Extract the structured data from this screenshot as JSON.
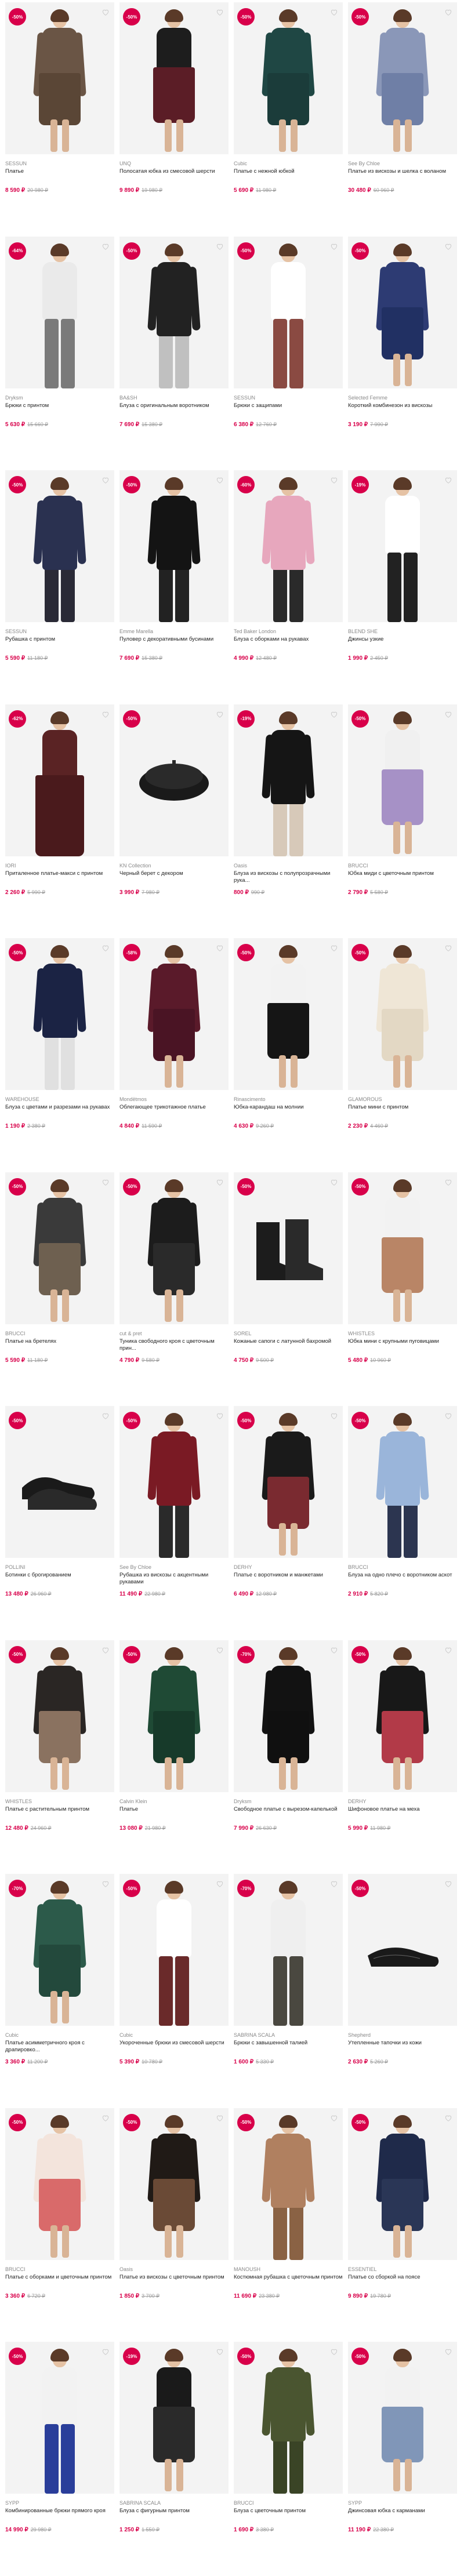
{
  "colors": {
    "accent": "#d8004a",
    "muted": "#9a9a9a"
  },
  "products": [
    {
      "badge": "-50%",
      "brand": "SESSUN",
      "name": "Платье",
      "price": "8 590 ₽",
      "old": "20 980 ₽",
      "kind": "dress",
      "c1": "#6a5545",
      "c2": "#5a4636"
    },
    {
      "badge": "-50%",
      "brand": "UNQ",
      "name": "Полосатая юбка из смесовой шерсти",
      "price": "9 890 ₽",
      "old": "19 980 ₽",
      "kind": "skirt",
      "c1": "#1d1d1d",
      "c2": "#5b1d26"
    },
    {
      "badge": "-50%",
      "brand": "Cubic",
      "name": "Платье с нежной юбкой",
      "price": "5 690 ₽",
      "old": "11 980 ₽",
      "kind": "dress",
      "c1": "#1f4744",
      "c2": "#1b3c3a"
    },
    {
      "badge": "-50%",
      "brand": "See By Chloe",
      "name": "Платье из вискозы и шелка с воланом",
      "price": "30 480 ₽",
      "old": "60 960 ₽",
      "kind": "dress",
      "c1": "#8a97b8",
      "c2": "#6f7fa6"
    },
    {
      "badge": "-64%",
      "brand": "Dryksm",
      "name": "Брюки с принтом",
      "price": "5 630 ₽",
      "old": "15 660 ₽",
      "kind": "pants",
      "c1": "#eaeaea",
      "c2": "#7a7a7a"
    },
    {
      "badge": "-50%",
      "brand": "BA&SH",
      "name": "Блуза с оригинальным воротником",
      "price": "7 690 ₽",
      "old": "15 380 ₽",
      "kind": "blouse",
      "c1": "#222222",
      "c2": "#c0c0c0"
    },
    {
      "badge": "-50%",
      "brand": "SESSUN",
      "name": "Брюки с защипами",
      "price": "6 380 ₽",
      "old": "12 760 ₽",
      "kind": "pants",
      "c1": "#ffffff",
      "c2": "#8a4a42"
    },
    {
      "badge": "-50%",
      "brand": "Selected Femme",
      "name": "Короткий комбинезон из вискозы",
      "price": "3 190 ₽",
      "old": "7 990 ₽",
      "kind": "dress",
      "c1": "#2d3b73",
      "c2": "#213063"
    },
    {
      "badge": "-50%",
      "brand": "SESSUN",
      "name": "Рубашка с принтом",
      "price": "5 590 ₽",
      "old": "11 180 ₽",
      "kind": "blouse",
      "c1": "#2a3150",
      "c2": "#2a2a36"
    },
    {
      "badge": "-50%",
      "brand": "Emme Marella",
      "name": "Пуловер с декоративными бусинами",
      "price": "7 690 ₽",
      "old": "15 380 ₽",
      "kind": "blouse",
      "c1": "#141414",
      "c2": "#222222"
    },
    {
      "badge": "-60%",
      "brand": "Ted Baker London",
      "name": "Блуза с оборками на рукавах",
      "price": "4 990 ₽",
      "old": "12 480 ₽",
      "kind": "blouse",
      "c1": "#e7a7bd",
      "c2": "#2a2a2a"
    },
    {
      "badge": "-19%",
      "brand": "BLEND SHE",
      "name": "Джинсы узкие",
      "price": "1 990 ₽",
      "old": "2 450 ₽",
      "kind": "pants",
      "c1": "#ffffff",
      "c2": "#222222"
    },
    {
      "badge": "-62%",
      "brand": "IORI",
      "name": "Приталенное платье-макси с принтом",
      "price": "2 260 ₽",
      "old": "5 990 ₽",
      "kind": "maxi",
      "c1": "#5a2324",
      "c2": "#4a1a1c"
    },
    {
      "badge": "-50%",
      "brand": "KN Collection",
      "name": "Черный берет с декором",
      "price": "3 990 ₽",
      "old": "7 980 ₽",
      "kind": "beret",
      "c1": "#1a1a1a",
      "c2": "#1a1a1a"
    },
    {
      "badge": "-19%",
      "brand": "Oasis",
      "name": "Блуза из вискозы с полупрозрачными рука...",
      "price": "800 ₽",
      "old": "990 ₽",
      "kind": "blouse",
      "c1": "#151515",
      "c2": "#d7c9b9"
    },
    {
      "badge": "-50%",
      "brand": "BRUCCI",
      "name": "Юбка миди с цветочным принтом",
      "price": "2 790 ₽",
      "old": "5 580 ₽",
      "kind": "skirt",
      "c1": "#f0f0f0",
      "c2": "#a691c6"
    },
    {
      "badge": "-50%",
      "brand": "WAREHOUSE",
      "name": "Блуза с цветами и разрезами на рукавах",
      "price": "1 190 ₽",
      "old": "2 380 ₽",
      "kind": "blouse",
      "c1": "#1b2344",
      "c2": "#e0e0e0"
    },
    {
      "badge": "-58%",
      "brand": "Mondëtmos",
      "name": "Облегающее трикотажное платье",
      "price": "4 840 ₽",
      "old": "11 590 ₽",
      "kind": "dress",
      "c1": "#5a1a2a",
      "c2": "#4a1424"
    },
    {
      "badge": "-50%",
      "brand": "Rinascimento",
      "name": "Юбка-карандаш на молнии",
      "price": "4 630 ₽",
      "old": "9 260 ₽",
      "kind": "skirt",
      "c1": "#f2f2f2",
      "c2": "#151515"
    },
    {
      "badge": "-50%",
      "brand": "GLAMOROUS",
      "name": "Платье мини с принтом",
      "price": "2 230 ₽",
      "old": "4 460 ₽",
      "kind": "dress",
      "c1": "#efe6d6",
      "c2": "#e3d8c4"
    },
    {
      "badge": "-50%",
      "brand": "BRUCCI",
      "name": "Платье на бретелях",
      "price": "5 590 ₽",
      "old": "11 180 ₽",
      "kind": "dress",
      "c1": "#3a3a3a",
      "c2": "#6e6050"
    },
    {
      "badge": "-50%",
      "brand": "cut & pret",
      "name": "Туника свободного кроя с цветочным прин...",
      "price": "4 790 ₽",
      "old": "9 580 ₽",
      "kind": "dress",
      "c1": "#1c1c1c",
      "c2": "#2a2a2a"
    },
    {
      "badge": "-50%",
      "brand": "SOREL",
      "name": "Кожаные сапоги с латунной бахромой",
      "price": "4 750 ₽",
      "old": "9 500 ₽",
      "kind": "boots",
      "c1": "#1c1c1c",
      "c2": "#1c1c1c"
    },
    {
      "badge": "-50%",
      "brand": "WHISTLES",
      "name": "Юбка мини с крупными пуговицами",
      "price": "5 480 ₽",
      "old": "10 960 ₽",
      "kind": "skirt",
      "c1": "#f2f2f2",
      "c2": "#b98566"
    },
    {
      "badge": "-50%",
      "brand": "POLLINI",
      "name": "Ботинки с брогированием",
      "price": "13 480 ₽",
      "old": "26 960 ₽",
      "kind": "shoes",
      "c1": "#1a1a1a",
      "c2": "#1a1a1a"
    },
    {
      "badge": "-50%",
      "brand": "See By Chloe",
      "name": "Рубашка из вискозы с акцентными рукавами",
      "price": "11 490 ₽",
      "old": "22 980 ₽",
      "kind": "blouse",
      "c1": "#7a1a24",
      "c2": "#2a2a2a"
    },
    {
      "badge": "-50%",
      "brand": "DERHY",
      "name": "Платье с воротником и манжетами",
      "price": "6 490 ₽",
      "old": "12 980 ₽",
      "kind": "dress",
      "c1": "#1a1a1a",
      "c2": "#7a2a30"
    },
    {
      "badge": "-50%",
      "brand": "BRUCCI",
      "name": "Блуза на одно плечо с воротником аскот",
      "price": "2 910 ₽",
      "old": "5 820 ₽",
      "kind": "blouse",
      "c1": "#9ab5da",
      "c2": "#2c3550"
    },
    {
      "badge": "-50%",
      "brand": "WHISTLES",
      "name": "Платье с растительным принтом",
      "price": "12 480 ₽",
      "old": "24 960 ₽",
      "kind": "dress",
      "c1": "#2a2624",
      "c2": "#8a7260"
    },
    {
      "badge": "-50%",
      "brand": "Calvin Klein",
      "name": "Платье",
      "price": "13 080 ₽",
      "old": "21 980 ₽",
      "kind": "dress",
      "c1": "#1f4a35",
      "c2": "#173a2a"
    },
    {
      "badge": "-70%",
      "brand": "Dryksm",
      "name": "Свободное платье с вырезом-капелькой",
      "price": "7 990 ₽",
      "old": "26 630 ₽",
      "kind": "dress",
      "c1": "#121212",
      "c2": "#101010"
    },
    {
      "badge": "-50%",
      "brand": "DERHY",
      "name": "Шифоновое платье на меха",
      "price": "5 990 ₽",
      "old": "11 980 ₽",
      "kind": "dress",
      "c1": "#181818",
      "c2": "#b23a48"
    },
    {
      "badge": "-70%",
      "brand": "Cubic",
      "name": "Платье асимметричного кроя с драпировко...",
      "price": "3 360 ₽",
      "old": "11 200 ₽",
      "kind": "dress",
      "c1": "#2c5a4a",
      "c2": "#23493c"
    },
    {
      "badge": "-50%",
      "brand": "Cubic",
      "name": "Укороченные брюки из смесовой шерсти",
      "price": "5 390 ₽",
      "old": "10 780 ₽",
      "kind": "pants",
      "c1": "#ffffff",
      "c2": "#6a2a2a"
    },
    {
      "badge": "-70%",
      "brand": "SABRINA SCALA",
      "name": "Брюки с завышенной талией",
      "price": "1 600 ₽",
      "old": "5 330 ₽",
      "kind": "pants",
      "c1": "#efefef",
      "c2": "#4a4840"
    },
    {
      "badge": "-50%",
      "brand": "Shepherd",
      "name": "Утепленные тапочки из кожи",
      "price": "2 630 ₽",
      "old": "5 260 ₽",
      "kind": "slippers",
      "c1": "#1a1a1a",
      "c2": "#1a1a1a"
    },
    {
      "badge": "-50%",
      "brand": "BRUCCI",
      "name": "Платье с оборками и цветочным принтом",
      "price": "3 360 ₽",
      "old": "6 720 ₽",
      "kind": "dress",
      "c1": "#f3e4dc",
      "c2": "#d96a6a"
    },
    {
      "badge": "-50%",
      "brand": "Oasis",
      "name": "Платье из вискозы с цветочным принтом",
      "price": "1 850 ₽",
      "old": "3 700 ₽",
      "kind": "dress",
      "c1": "#201a16",
      "c2": "#6a4a36"
    },
    {
      "badge": "-50%",
      "brand": "MANOUSH",
      "name": "Костюмная рубашка с цветочным принтом",
      "price": "11 690 ₽",
      "old": "23 380 ₽",
      "kind": "blouse",
      "c1": "#b08060",
      "c2": "#8a6244"
    },
    {
      "badge": "-50%",
      "brand": "ESSENTIEL",
      "name": "Платье со сборкой на поясе",
      "price": "9 890 ₽",
      "old": "19 780 ₽",
      "kind": "dress",
      "c1": "#1f2a4a",
      "c2": "#2a3656"
    },
    {
      "badge": "-50%",
      "brand": "SYPP",
      "name": "Комбинированные брюки прямого кроя",
      "price": "14 990 ₽",
      "old": "29 980 ₽",
      "kind": "pants",
      "c1": "#f2f2f2",
      "c2": "#2a3e9a"
    },
    {
      "badge": "-19%",
      "brand": "SABRINA SCALA",
      "name": "Блуза с фигурным принтом",
      "price": "1 250 ₽",
      "old": "1 550 ₽",
      "kind": "skirt",
      "c1": "#1a1a1a",
      "c2": "#2a2a2a"
    },
    {
      "badge": "-50%",
      "brand": "BRUCCI",
      "name": "Блуза с цветочным принтом",
      "price": "1 690 ₽",
      "old": "3 380 ₽",
      "kind": "blouse",
      "c1": "#4a5530",
      "c2": "#3a4426"
    },
    {
      "badge": "-50%",
      "brand": "SYPP",
      "name": "Джинсовая юбка с карманами",
      "price": "11 190 ₽",
      "old": "22 380 ₽",
      "kind": "skirt",
      "c1": "#f2f2f2",
      "c2": "#8096b8"
    }
  ]
}
